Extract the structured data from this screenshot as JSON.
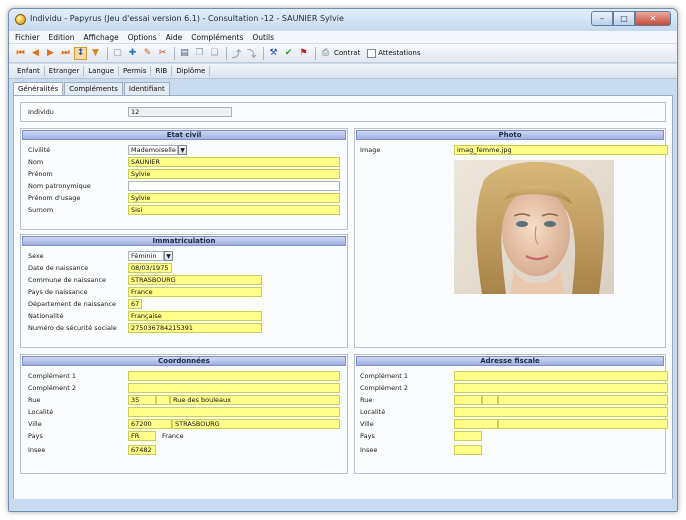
{
  "window": {
    "title": "Individu - Papyrus (Jeu d'essai version 6.1) - Consultation -12 - SAUNIER Sylvie",
    "minimize": "–",
    "maximize": "□",
    "close": "✕"
  },
  "menu": [
    "Fichier",
    "Edition",
    "Affichage",
    "Options",
    "Aide",
    "Compléments",
    "Outils"
  ],
  "toolbar": {
    "contrat_label": "Contrat",
    "attestations_label": "Attestations"
  },
  "nav_tabs": [
    "Enfant",
    "Etranger",
    "Langue",
    "Permis",
    "RIB",
    "Diplôme"
  ],
  "subtabs": [
    "Généralités",
    "Compléments",
    "Identifiant"
  ],
  "individu": {
    "label": "Individu",
    "value": "12"
  },
  "etat_civil": {
    "header": "Etat civil",
    "civilite": {
      "label": "Civilité",
      "value": "Mademoiselle"
    },
    "nom": {
      "label": "Nom",
      "value": "SAUNIER"
    },
    "prenom": {
      "label": "Prénom",
      "value": "Sylvie"
    },
    "nom_patronymique": {
      "label": "Nom patronymique",
      "value": ""
    },
    "prenom_usage": {
      "label": "Prénom d'usage",
      "value": "Sylvie"
    },
    "surnom": {
      "label": "Surnom",
      "value": "Sisi"
    }
  },
  "photo": {
    "header": "Photo",
    "image_label": "Image",
    "image_value": "imag_femme.jpg"
  },
  "immatriculation": {
    "header": "Immatriculation",
    "sexe": {
      "label": "Sexe",
      "value": "Féminin"
    },
    "date_naissance": {
      "label": "Date de naissance",
      "value": "08/03/1975"
    },
    "commune_naissance": {
      "label": "Commune de naissance",
      "value": "STRASBOURG"
    },
    "pays_naissance": {
      "label": "Pays de naissance",
      "value": "France"
    },
    "departement_naissance": {
      "label": "Département de naissance",
      "value": "67"
    },
    "nationalite": {
      "label": "Nationalité",
      "value": "Française"
    },
    "numero_secu": {
      "label": "Numéro de sécurité sociale",
      "value": "275036784215391"
    }
  },
  "coordonnees": {
    "header": "Coordonnées",
    "complement1": {
      "label": "Complément 1",
      "value": ""
    },
    "complement2": {
      "label": "Complément 2",
      "value": ""
    },
    "rue": {
      "label": "Rue",
      "numero": "35",
      "bis": "",
      "value": "Rue des bouleaux"
    },
    "localite": {
      "label": "Localité",
      "value": ""
    },
    "ville": {
      "label": "Ville",
      "cp": "67200",
      "value": "STRASBOURG"
    },
    "pays": {
      "label": "Pays",
      "code": "FR",
      "value": "France"
    },
    "insee": {
      "label": "Insee",
      "value": "67482"
    }
  },
  "adresse_fiscale": {
    "header": "Adresse fiscale",
    "complement1": {
      "label": "Complément 1"
    },
    "complement2": {
      "label": "Complément 2"
    },
    "rue": {
      "label": "Rue"
    },
    "localite": {
      "label": "Localité"
    },
    "ville": {
      "label": "Ville"
    },
    "pays": {
      "label": "Pays"
    },
    "insee": {
      "label": "Insee"
    }
  }
}
